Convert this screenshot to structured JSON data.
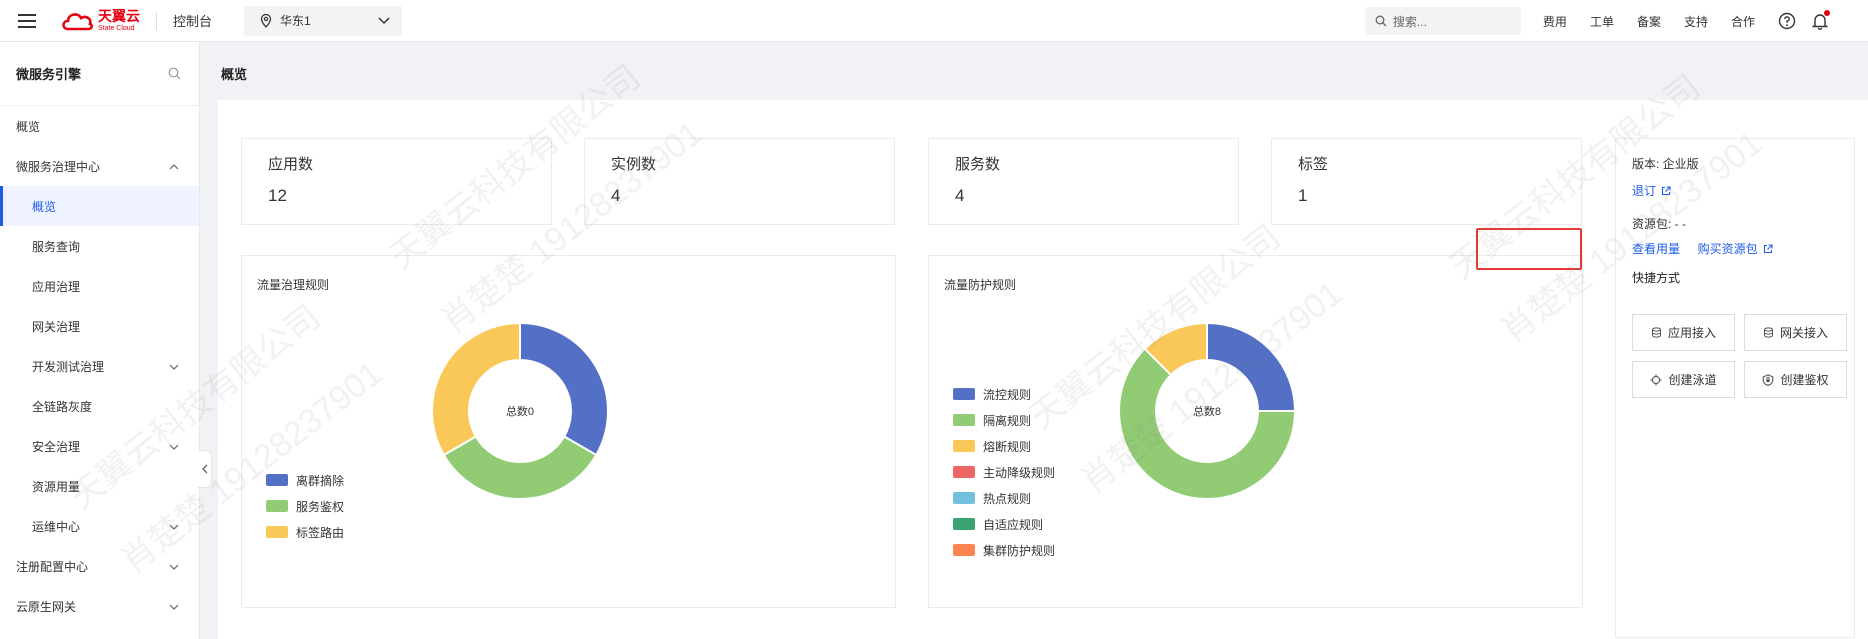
{
  "topbar": {
    "logo_cn": "天翼云",
    "logo_en": "State Cloud",
    "console": "控制台",
    "region": "华东1",
    "search_placeholder": "搜索...",
    "links": [
      "费用",
      "工单",
      "备案",
      "支持",
      "合作"
    ]
  },
  "sidebar": {
    "title": "微服务引擎",
    "items": [
      {
        "label": "概览",
        "level": 0,
        "chevron": "none"
      },
      {
        "label": "微服务治理中心",
        "level": 0,
        "chevron": "up"
      },
      {
        "label": "概览",
        "level": 1,
        "chevron": "none",
        "active": true
      },
      {
        "label": "服务查询",
        "level": 1,
        "chevron": "none"
      },
      {
        "label": "应用治理",
        "level": 1,
        "chevron": "none"
      },
      {
        "label": "网关治理",
        "level": 1,
        "chevron": "none"
      },
      {
        "label": "开发测试治理",
        "level": 1,
        "chevron": "down"
      },
      {
        "label": "全链路灰度",
        "level": 1,
        "chevron": "none"
      },
      {
        "label": "安全治理",
        "level": 1,
        "chevron": "down"
      },
      {
        "label": "资源用量",
        "level": 1,
        "chevron": "none"
      },
      {
        "label": "运维中心",
        "level": 1,
        "chevron": "down"
      },
      {
        "label": "注册配置中心",
        "level": 0,
        "chevron": "down"
      },
      {
        "label": "云原生网关",
        "level": 0,
        "chevron": "down"
      }
    ]
  },
  "page_title": "概览",
  "stats": [
    {
      "label": "应用数",
      "value": "12"
    },
    {
      "label": "实例数",
      "value": "4"
    },
    {
      "label": "服务数",
      "value": "4"
    },
    {
      "label": "标签",
      "value": "1"
    }
  ],
  "side_panel": {
    "version_label": "版本: 企业版",
    "unsubscribe": "退订",
    "resource_pack_label": "资源包: - -",
    "view_usage": "查看用量",
    "buy_pack": "购买资源包",
    "quick_title": "快捷方式",
    "quick_buttons": [
      "应用接入",
      "网关接入",
      "创建泳道",
      "创建鉴权"
    ]
  },
  "colors": {
    "blue": "#5470c6",
    "green": "#91cc75",
    "yellow": "#fac858",
    "red": "#ee6666",
    "lightblue": "#73c0de",
    "teal": "#3ba272",
    "orange": "#fc8452",
    "accent": "#1f5bea"
  },
  "watermark": {
    "company": "天翼云科技有限公司",
    "person": "肖楚楚 19128237901"
  },
  "chart_data": [
    {
      "type": "pie",
      "title": "流量治理规则",
      "center_label": "总数0",
      "categories": [
        "离群摘除",
        "服务鉴权",
        "标签路由"
      ],
      "values": [
        0,
        0,
        0
      ],
      "display_fractions": [
        0.3333,
        0.3333,
        0.3334
      ],
      "colors": [
        "#5470c6",
        "#91cc75",
        "#fac858"
      ]
    },
    {
      "type": "pie",
      "title": "流量防护规则",
      "center_label": "总数8",
      "categories": [
        "流控规则",
        "隔离规则",
        "熔断规则",
        "主动降级规则",
        "热点规则",
        "自适应规则",
        "集群防护规则"
      ],
      "values": [
        2,
        5,
        1,
        0,
        0,
        0,
        0
      ],
      "colors": [
        "#5470c6",
        "#91cc75",
        "#fac858",
        "#ee6666",
        "#73c0de",
        "#3ba272",
        "#fc8452"
      ]
    }
  ]
}
